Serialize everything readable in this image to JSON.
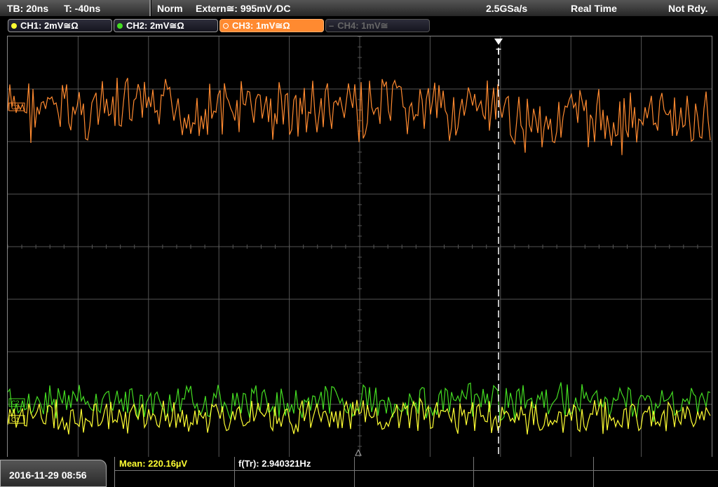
{
  "status": {
    "timebase": "TB: 20ns",
    "trigger_time": "T: -40ns",
    "mode": "Norm",
    "trigger_source": "Extern≅: 995mV ⁄DC",
    "sample_rate": "2.5GSa/s",
    "acq_mode": "Real Time",
    "state": "Not Rdy."
  },
  "channels": [
    {
      "label": "CH1: 2mV≅Ω",
      "color": "#ffff33"
    },
    {
      "label": "CH2: 2mV≅Ω",
      "color": "#44dd22"
    },
    {
      "label": "CH3: 1mV≅Ω",
      "color": "#ff8a30"
    },
    {
      "label": "CH4: 1mV≅",
      "color": "#555555"
    }
  ],
  "markers": {
    "trigger": "T",
    "ch3": "C3",
    "ch2": "C2",
    "ch1": "C1"
  },
  "footer": {
    "datetime": "2016-11-29 08:56",
    "mean": "Mean: 220.16µV",
    "freq": "f(Tr): 2.940321Hz"
  },
  "colors": {
    "grid": "#555555",
    "ch1": "#ffff33",
    "ch2": "#44dd22",
    "ch3": "#ff8a30"
  }
}
